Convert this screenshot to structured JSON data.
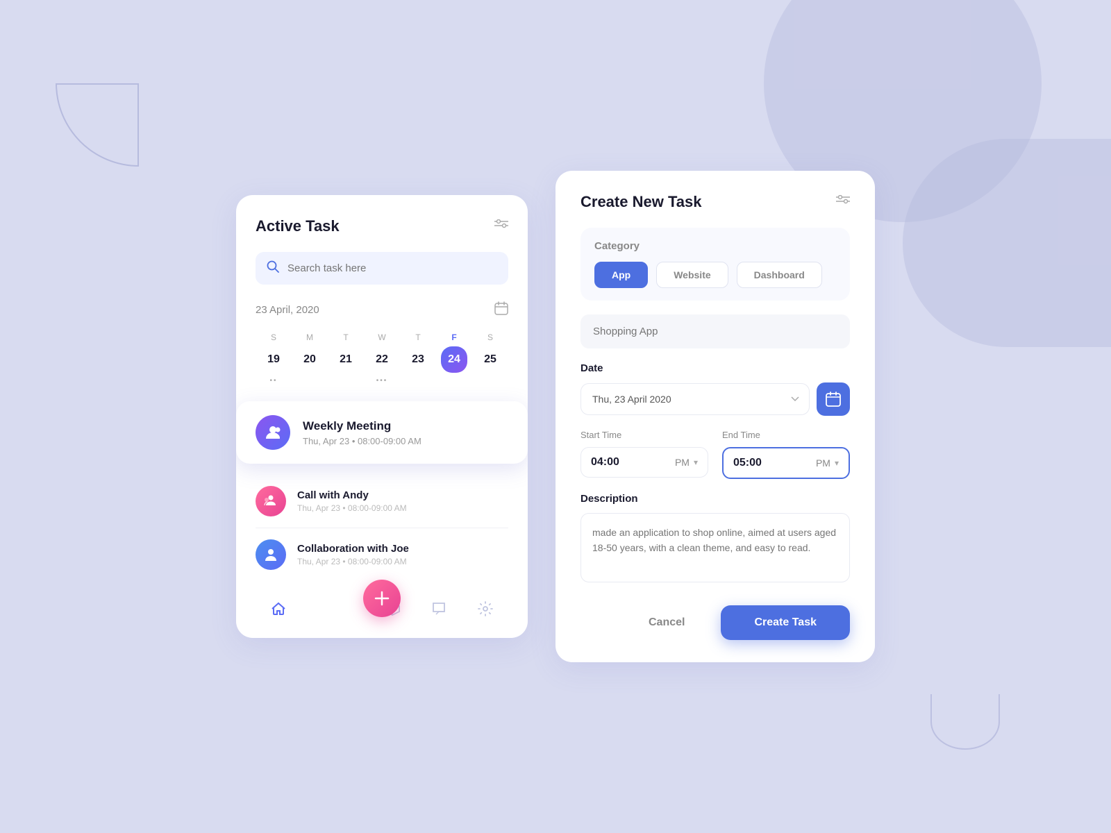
{
  "background": {
    "color": "#d8dbf0"
  },
  "leftCard": {
    "title": "Active Task",
    "filter_label": "filter-icon",
    "search": {
      "placeholder": "Search task here"
    },
    "date_label": "23 April, 2020",
    "week": {
      "days": [
        {
          "letter": "S",
          "num": "19",
          "dots": true,
          "active": false
        },
        {
          "letter": "M",
          "num": "20",
          "dots": false,
          "active": false
        },
        {
          "letter": "T",
          "num": "21",
          "dots": false,
          "active": false
        },
        {
          "letter": "W",
          "num": "22",
          "dots": true,
          "active": false
        },
        {
          "letter": "T",
          "num": "23",
          "dots": false,
          "active": false
        },
        {
          "letter": "F",
          "num": "24",
          "dots": true,
          "active": true
        },
        {
          "letter": "S",
          "num": "25",
          "dots": false,
          "active": false
        }
      ]
    },
    "activeTask": {
      "name": "Weekly Meeting",
      "time": "Thu, Apr 23 • 08:00-09:00 AM"
    },
    "tasks": [
      {
        "name": "Call with Andy",
        "time": "Thu, Apr 23 • 08:00-09:00 AM",
        "avatar_type": "pink"
      },
      {
        "name": "Collaboration with Joe",
        "time": "Thu, Apr 23 • 08:00-09:00 AM",
        "avatar_type": "blue"
      }
    ],
    "nav": {
      "items": [
        "home",
        "box",
        "chat",
        "settings"
      ]
    }
  },
  "rightCard": {
    "title": "Create New Task",
    "filter_label": "filter-icon",
    "category": {
      "label": "Category",
      "options": [
        "App",
        "Website",
        "Dashboard"
      ],
      "active": "App"
    },
    "task_name_placeholder": "Shopping App",
    "date": {
      "label": "Date",
      "value": "Thu, 23 April 2020"
    },
    "start_time": {
      "label": "Start Time",
      "value": "04:00",
      "ampm": "PM"
    },
    "end_time": {
      "label": "End Time",
      "value": "05:00",
      "ampm": "PM"
    },
    "description": {
      "label": "Description",
      "placeholder": "made an application to shop online, aimed at users aged 18-50 years, with a clean theme, and easy to read."
    },
    "cancel_label": "Cancel",
    "create_label": "Create Task"
  }
}
